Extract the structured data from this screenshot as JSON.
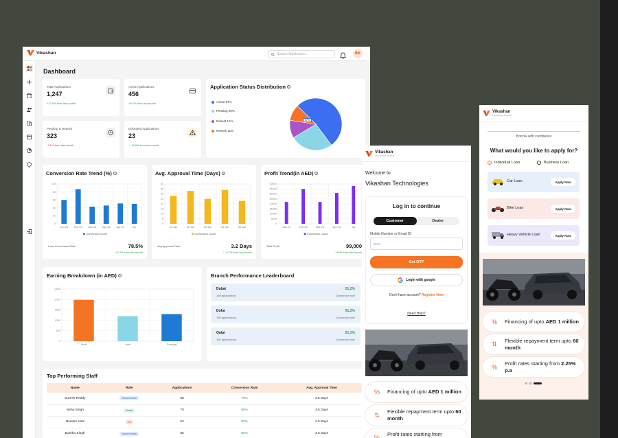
{
  "brand": "Vikashan",
  "brand_tagline": "TECHNOLOGIES",
  "colors": {
    "accent": "#f47424",
    "bg": "#43483f",
    "blue": "#1f7ad4",
    "yellow": "#f4b71c",
    "purple": "#7b2ff2"
  },
  "dashboard": {
    "search_placeholder": "Search Application...",
    "avatar": "BK",
    "title": "Dashboard",
    "sidebar_icons": [
      "grid-icon",
      "plus-icon",
      "building-icon",
      "users-icon",
      "office-icon",
      "calendar-icon",
      "chart-pie-icon",
      "shield-icon",
      "logout-icon"
    ],
    "stats": [
      {
        "label": "Total Applications",
        "value": "1,247",
        "trend": "+12.5% from last month",
        "dir": "up",
        "icon": "wallet-icon"
      },
      {
        "label": "Active Applications",
        "value": "456",
        "trend": "+8.2% from last month",
        "dir": "up",
        "icon": "card-icon"
      },
      {
        "label": "Pending & Rework",
        "value": "323",
        "trend": "-3.1% from last month",
        "dir": "down",
        "icon": "history-icon"
      },
      {
        "label": "Defaulted Applications",
        "value": "23",
        "trend": "↓ -15.6% from last month",
        "dir": "up",
        "icon": "warning-icon"
      }
    ],
    "status_title": "Application Status Distribution",
    "status": [
      {
        "label": "Active 57%",
        "color": "#3b6ef0"
      },
      {
        "label": "Pending 29%",
        "color": "#8ad6e6"
      },
      {
        "label": "Default 12%",
        "color": "#a855c9"
      },
      {
        "label": "Rework 11%",
        "color": "#f47424"
      }
    ],
    "pie_callout": "57%",
    "conv": {
      "title": "Conversion Rate Trend (%)",
      "legend": "Conversion Count",
      "foot_label": "Loan Conversion Rate",
      "foot_value": "78.5%",
      "foot_trend": "+2.3% from last month"
    },
    "appr": {
      "title": "Avg. Approval Time (Days)",
      "legend": "Conversion Count",
      "foot_label": "Avg Approval Time",
      "foot_value": "3.2 Days",
      "foot_trend": "↓ -0.7% from last month"
    },
    "profit": {
      "title": "Profit Trend(in AED)",
      "legend": "Conversion Count",
      "foot_label": "Total Profit",
      "foot_value": "99,000",
      "foot_trend": "+18% from last month"
    },
    "earning_title": "Earning Breakdown (in AED)",
    "branch_title": "Branch Performance Leaderboard",
    "branches": [
      {
        "name": "Dubai",
        "apps": "156 applications",
        "pct": "81.2%",
        "sub": "Conversion rate"
      },
      {
        "name": "Doha",
        "apps": "156 applications",
        "pct": "81.2%",
        "sub": "Conversion rate"
      },
      {
        "name": "Qatar",
        "apps": "156 applications",
        "pct": "81.2%",
        "sub": "Conversion rate"
      }
    ],
    "staff_title": "Top Performing Staff",
    "staff_headers": [
      "Name",
      "Role",
      "Applications",
      "Conversion Rate",
      "Avg. Approval Time"
    ],
    "staff": [
      {
        "name": "Suresh Reddy",
        "role": "Branch Admin",
        "apps": "68",
        "rate": "76%",
        "time": "3.5 Days"
      },
      {
        "name": "Neha Singh",
        "role": "Dealer",
        "apps": "70",
        "rate": "80%",
        "time": "3.5 Days"
      },
      {
        "name": "Neelam Vats",
        "role": "Hot",
        "apps": "52",
        "rate": "83%",
        "time": "2.5 Days"
      },
      {
        "name": "Barkha Singh",
        "role": "Branch Admin",
        "apps": "85",
        "rate": "80%",
        "time": "3.5 Days"
      }
    ]
  },
  "chart_data": [
    {
      "type": "bar",
      "title": "Conversion Rate Trend (%)",
      "categories": [
        "Jan 23",
        "Feb 23",
        "Mar 23",
        "Apr 23",
        "Apr 23",
        "Ap"
      ],
      "series": [
        {
          "name": "Conversion Count",
          "values": [
            60,
            87,
            43,
            46,
            51,
            50
          ]
        }
      ],
      "ylim": [
        0,
        100
      ],
      "yticks": [
        "0",
        "20",
        "40",
        "60",
        "80",
        "100"
      ]
    },
    {
      "type": "bar",
      "title": "Avg. Approval Time (Days)",
      "categories": [
        "01 Jan",
        "02 Jan",
        "03 Jan",
        "04 Jan",
        "05 Jan"
      ],
      "series": [
        {
          "name": "Conversion Count",
          "values": [
            28,
            33,
            25,
            34,
            23
          ]
        }
      ],
      "ylim": [
        0,
        40
      ],
      "yticks": [
        "0",
        "5",
        "10",
        "15",
        "20",
        "25",
        "30",
        "35",
        "40"
      ]
    },
    {
      "type": "bar",
      "title": "Profit Trend(in AED)",
      "categories": [
        "Jan 23",
        "Feb 23",
        "Mar 23",
        "Apr 23",
        "Ap"
      ],
      "series": [
        {
          "name": "Conversion Count",
          "values": [
            22000,
            35000,
            22000,
            31000,
            38000
          ]
        }
      ],
      "ylim": [
        0,
        40000
      ],
      "yticks": [
        "0",
        "5000",
        "10000",
        "15000",
        "20000",
        "25000",
        "30000",
        "35000",
        "40000"
      ]
    },
    {
      "type": "bar",
      "title": "Earning Breakdown (in AED)",
      "categories": [
        "Profit",
        "Loss",
        "Pending"
      ],
      "series": [
        {
          "name": "",
          "values": [
            1980,
            1200,
            1300
          ]
        }
      ],
      "colors": [
        "#f47424",
        "#8ad6e6",
        "#1f7ad4"
      ],
      "ylim": [
        0,
        2500
      ],
      "yticks": [
        "0",
        "500",
        "1000",
        "1500",
        "2000",
        "2500"
      ]
    },
    {
      "type": "pie",
      "title": "Application Status Distribution",
      "categories": [
        "Active",
        "Pending",
        "Default",
        "Rework"
      ],
      "values": [
        57,
        29,
        12,
        11
      ]
    }
  ],
  "login": {
    "welcome": "Welcome to",
    "company": "Vikashan Technologies",
    "heading": "Log in to continue",
    "tab_customer": "Customer",
    "tab_dealer": "Dealer",
    "field_label": "Mobile Number or Email ID",
    "field_placeholder": "Enter",
    "otp_button": "Get OTP",
    "google_button": "Login with google",
    "no_account": "Don't have account?",
    "register": "Register Now",
    "need_help": "Need Help?",
    "features": [
      {
        "icon": "percent-swap-icon",
        "prefix": "Financing of upto ",
        "bold": "AED 1 million"
      },
      {
        "icon": "repeat-icon",
        "prefix": "Flexible repayment term upto ",
        "bold": "60 month"
      },
      {
        "icon": "percent-icon",
        "prefix": "Profit rates starting from",
        "bold": ""
      }
    ]
  },
  "apply": {
    "tagline": "Borrow with confidence",
    "question": "What would you like to apply for?",
    "radio_individual": "Individual Loan",
    "radio_business": "Business Loan",
    "loans": [
      {
        "name": "Car Loan",
        "button": "Apply Now",
        "bg": "#e6f0fa"
      },
      {
        "name": "Bike Loan",
        "button": "Apply Now",
        "bg": "#fbe9e7"
      },
      {
        "name": "Heavy Vehicle Loan",
        "button": "Apply Now",
        "bg": "#ece8fb"
      }
    ],
    "features": [
      {
        "icon": "percent-swap-icon",
        "prefix": "Financing of upto ",
        "bold": "AED 1 million"
      },
      {
        "icon": "repeat-icon",
        "prefix": "Flexible repayment term upto ",
        "bold": "60 month"
      },
      {
        "icon": "percent-icon",
        "prefix": "Profit rates starting from ",
        "bold": "2.25% p.a"
      }
    ]
  }
}
